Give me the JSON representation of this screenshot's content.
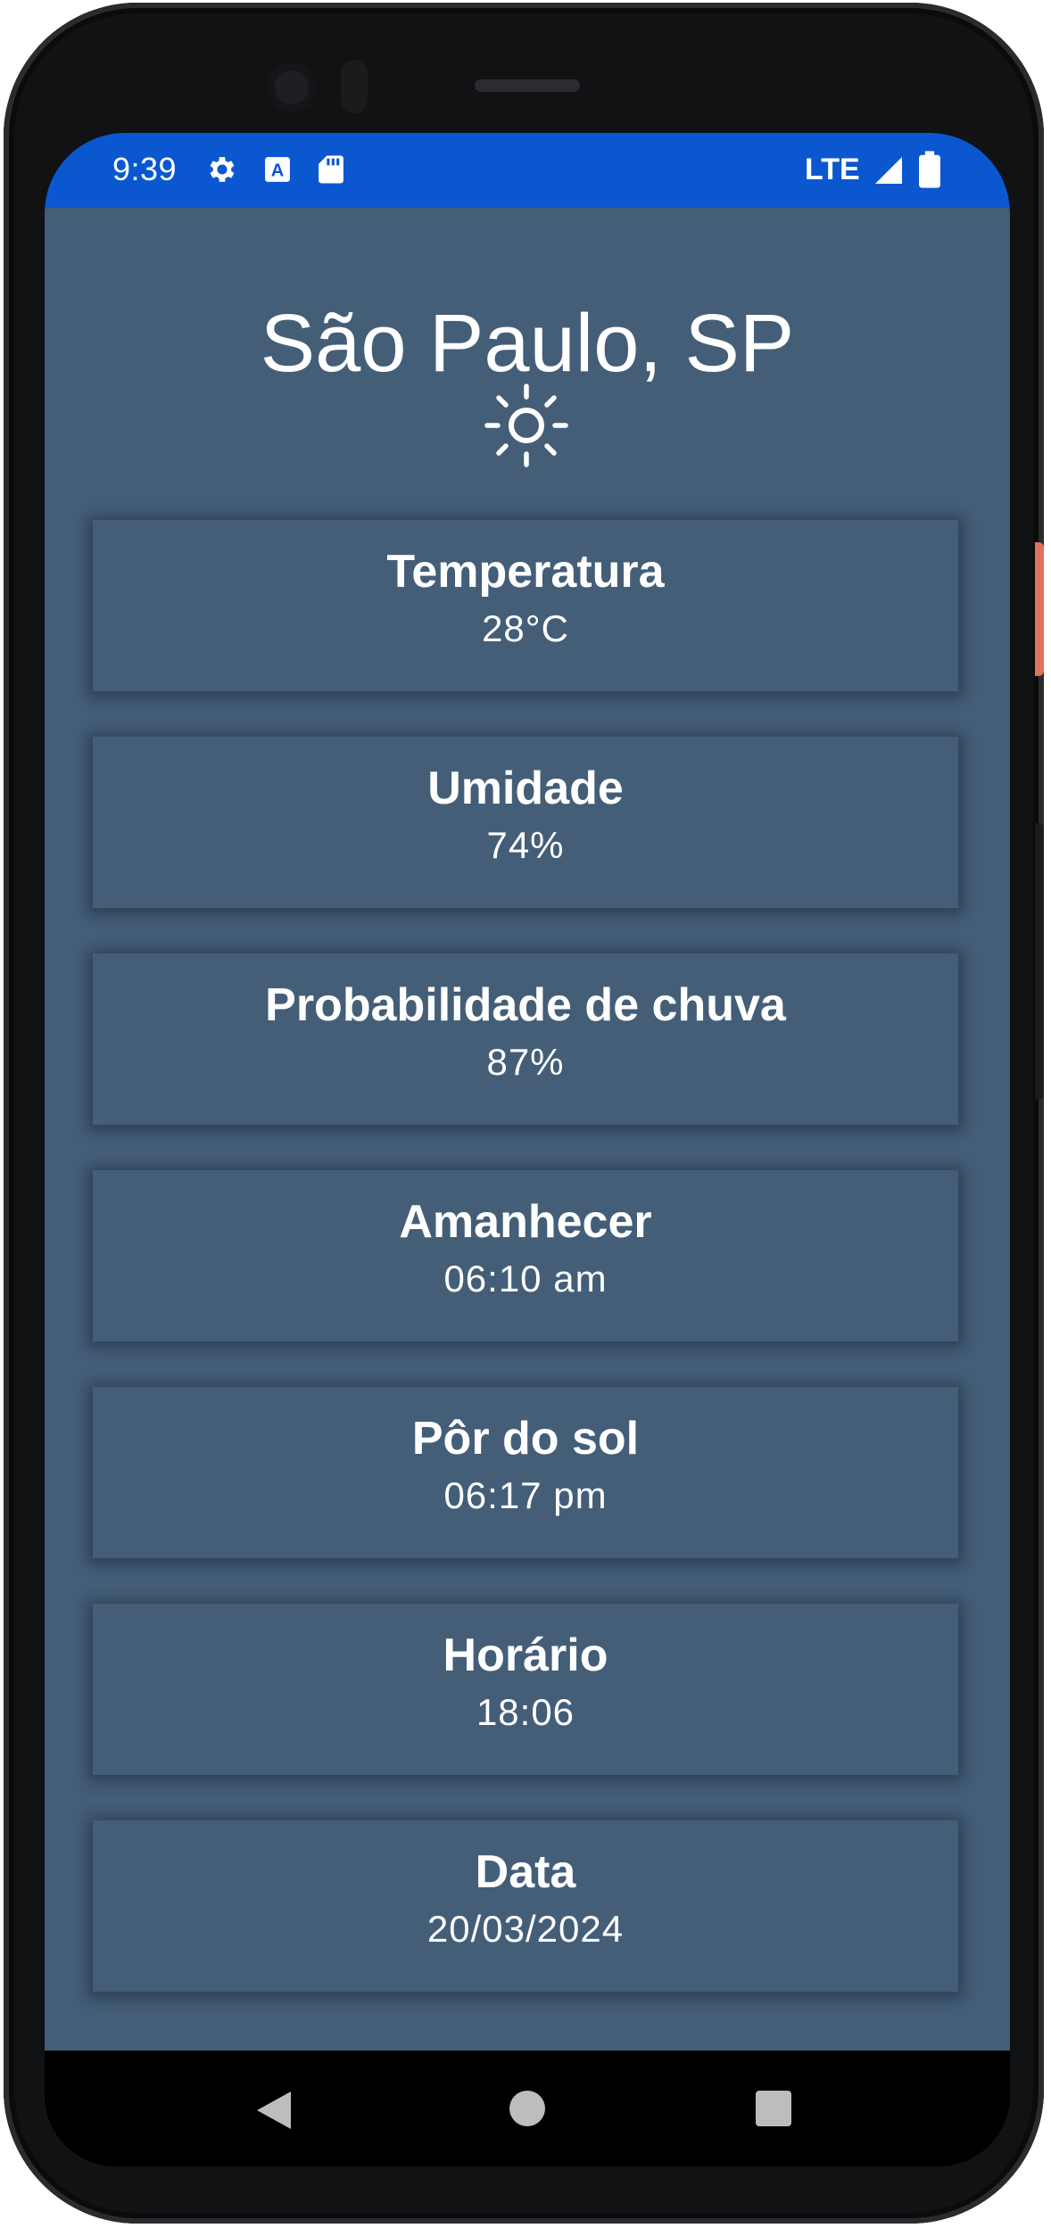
{
  "status_bar": {
    "time": "9:39",
    "network": "LTE",
    "icons": [
      "gear-icon",
      "text-a-icon",
      "sd-card-icon",
      "signal-icon",
      "battery-icon"
    ],
    "background_color": "#0b57d0"
  },
  "weather": {
    "city": "São Paulo, SP",
    "condition_icon": "sun-icon",
    "background_color": "#445e78",
    "cards": [
      {
        "title": "Temperatura",
        "value": "28°C"
      },
      {
        "title": "Umidade",
        "value": "74%"
      },
      {
        "title": "Probabilidade de chuva",
        "value": "87%"
      },
      {
        "title": "Amanhecer",
        "value": "06:10 am"
      },
      {
        "title": "Pôr do sol",
        "value": "06:17 pm"
      },
      {
        "title": "Horário",
        "value": "18:06"
      },
      {
        "title": "Data",
        "value": "20/03/2024"
      }
    ]
  },
  "nav_bar": {
    "buttons": [
      "back-icon",
      "home-icon",
      "recents-icon"
    ]
  }
}
